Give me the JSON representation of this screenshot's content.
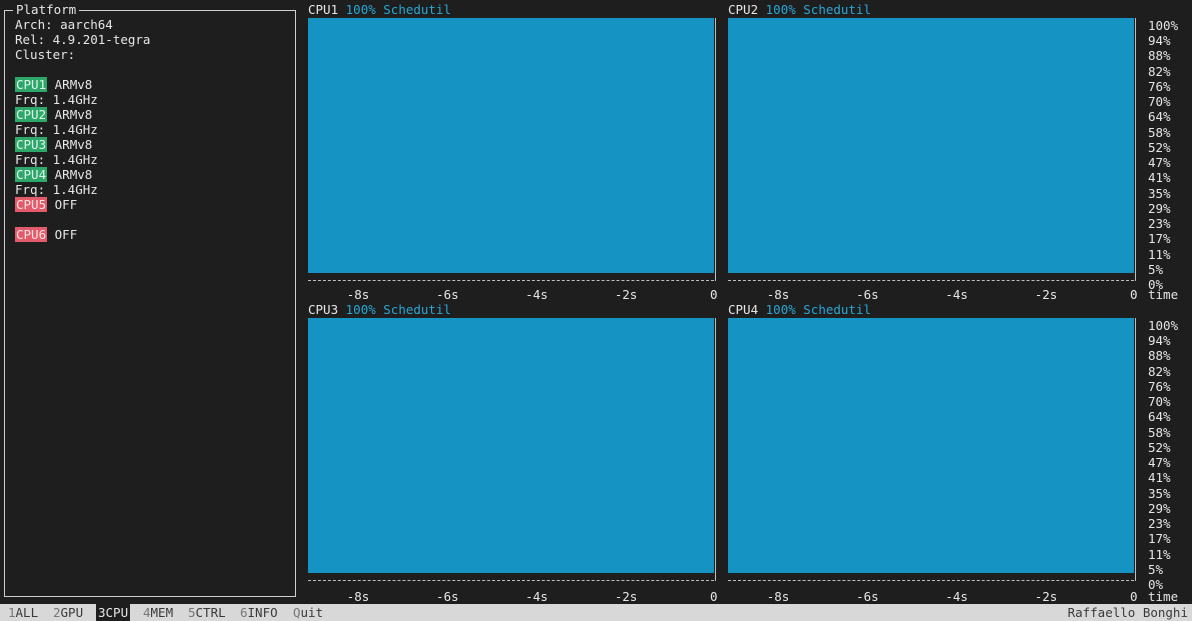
{
  "platform": {
    "title": "Platform",
    "arch": "Arch: aarch64",
    "rel": "Rel: 4.9.201-tegra",
    "cluster": "Cluster:",
    "cpus": [
      {
        "name": "CPU1",
        "model": "ARMv8",
        "freq": "Frq: 1.4GHz",
        "state": "on"
      },
      {
        "name": "CPU2",
        "model": "ARMv8",
        "freq": "Frq: 1.4GHz",
        "state": "on"
      },
      {
        "name": "CPU3",
        "model": "ARMv8",
        "freq": "Frq: 1.4GHz",
        "state": "on"
      },
      {
        "name": "CPU4",
        "model": "ARMv8",
        "freq": "Frq: 1.4GHz",
        "state": "on"
      },
      {
        "name": "CPU5",
        "model": "OFF",
        "freq": "",
        "state": "off"
      },
      {
        "name": "CPU6",
        "model": "OFF",
        "freq": "",
        "state": "off"
      }
    ]
  },
  "charts": [
    {
      "name": "CPU1",
      "util": "100% Schedutil",
      "value_percent": 100
    },
    {
      "name": "CPU2",
      "util": "100% Schedutil",
      "value_percent": 100
    },
    {
      "name": "CPU3",
      "util": "100% Schedutil",
      "value_percent": 100
    },
    {
      "name": "CPU4",
      "util": "100% Schedutil",
      "value_percent": 100
    }
  ],
  "y_ticks": [
    "100%",
    "94%",
    "88%",
    "82%",
    "76%",
    "70%",
    "64%",
    "58%",
    "52%",
    "47%",
    "41%",
    "35%",
    "29%",
    "23%",
    "17%",
    "11%",
    "5%",
    "0%"
  ],
  "x_ticks": [
    "-8s",
    "-6s",
    "-4s",
    "-2s",
    "0"
  ],
  "x_axis_label": "time",
  "menu": [
    {
      "num": "1",
      "label": "ALL",
      "active": false
    },
    {
      "num": "2",
      "label": "GPU",
      "active": false
    },
    {
      "num": "3",
      "label": "CPU",
      "active": true
    },
    {
      "num": "4",
      "label": "MEM",
      "active": false
    },
    {
      "num": "5",
      "label": "CTRL",
      "active": false
    },
    {
      "num": "6",
      "label": "INFO",
      "active": false
    },
    {
      "num": "Q",
      "label": "uit",
      "active": false
    }
  ],
  "author": "Raffaello Bonghi",
  "colors": {
    "plot_fill": "#1593c2",
    "util_text": "#2aa6d4",
    "cpu_on": "#2ea86a",
    "cpu_off": "#e35b6a"
  }
}
